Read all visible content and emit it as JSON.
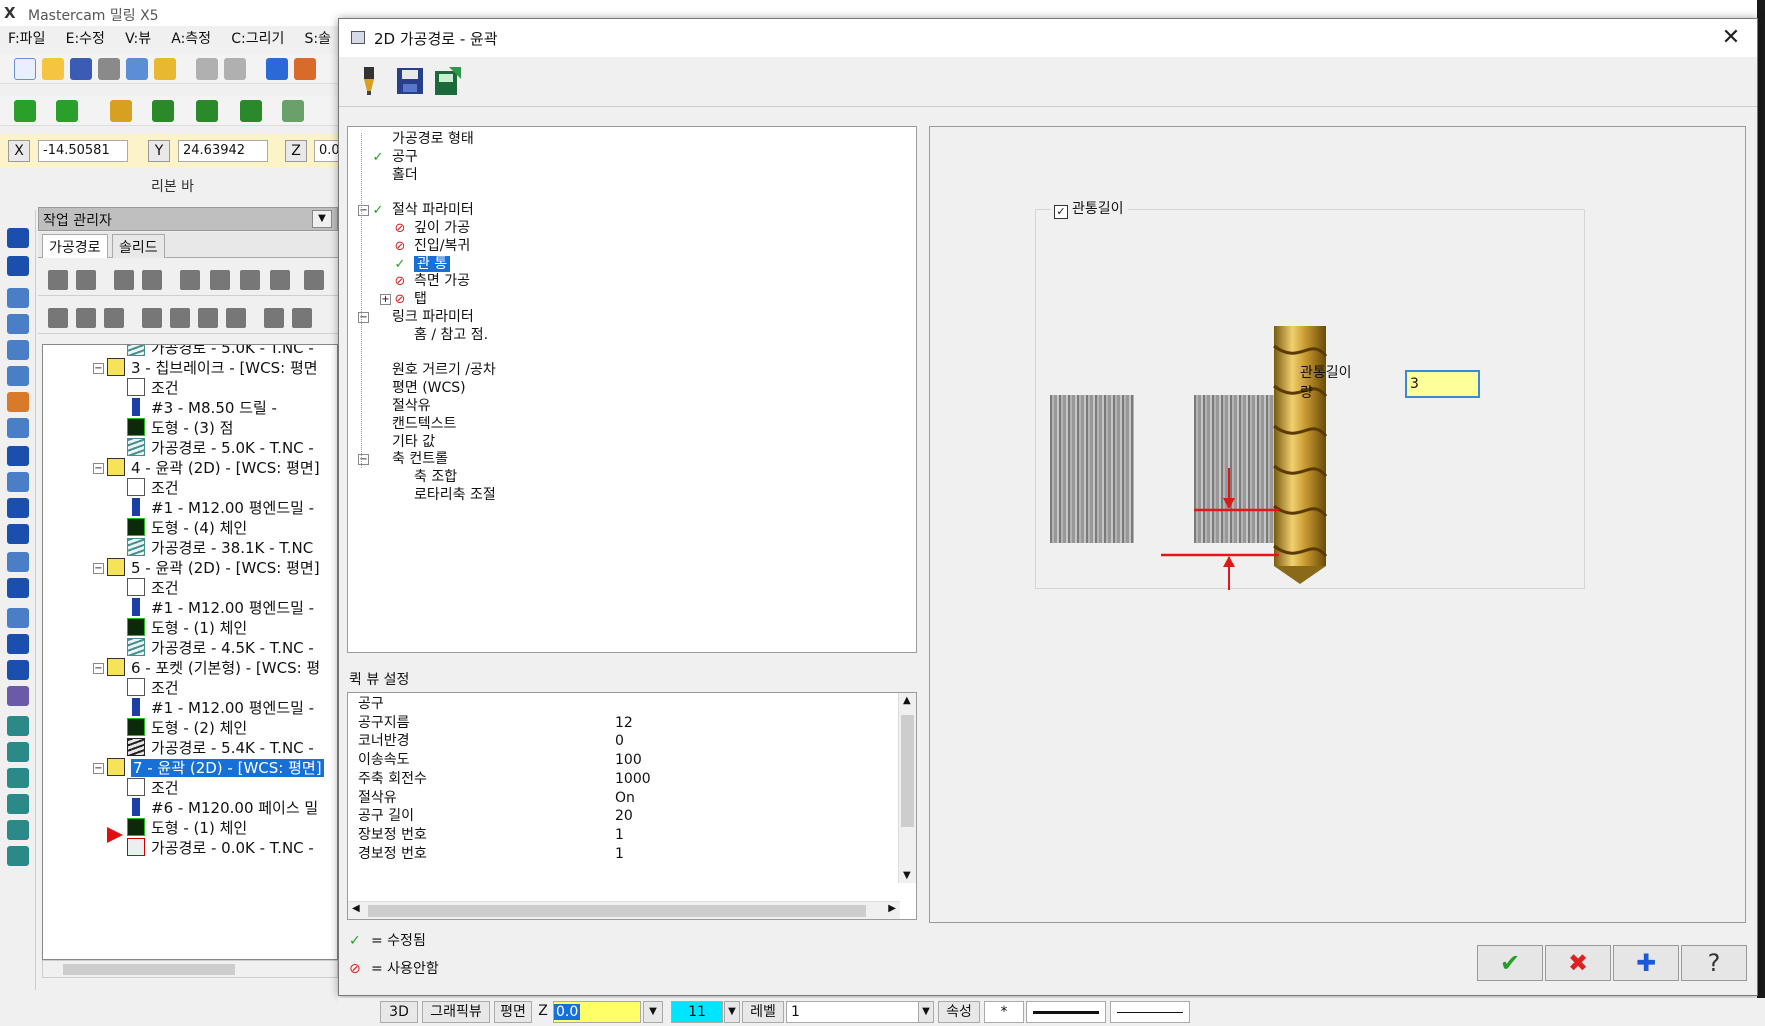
{
  "app": {
    "title": "Mastercam 밀링 X5",
    "menu": [
      "F:파일",
      "E:수정",
      "V:뷰",
      "A:측정",
      "C:그리기",
      "S:솔"
    ],
    "coords": {
      "x_label": "X",
      "x_value": "-14.50581",
      "y_label": "Y",
      "y_value": "24.63942",
      "z_label": "Z",
      "z_value": "0.0"
    },
    "ribbon_label": "리본 바"
  },
  "manager": {
    "title": "작업 관리자",
    "tabs": [
      "가공경로",
      "솔리드"
    ],
    "tree": [
      {
        "text": "가공경로 - 5.0K - T.NC -",
        "icon": "path",
        "level": 2
      },
      {
        "text": "3 - 칩브레이크 - [WCS: 평면",
        "icon": "folder",
        "level": 1
      },
      {
        "text": "조건",
        "icon": "cond",
        "level": 2
      },
      {
        "text": "#3 - M8.50 드릴 -",
        "icon": "tool",
        "level": 2
      },
      {
        "text": "도형 - (3) 점",
        "icon": "geo",
        "level": 2
      },
      {
        "text": "가공경로 - 5.0K - T.NC -",
        "icon": "path",
        "level": 2
      },
      {
        "text": "4 - 윤곽 (2D) - [WCS: 평면]",
        "icon": "folder",
        "level": 1
      },
      {
        "text": "조건",
        "icon": "cond",
        "level": 2
      },
      {
        "text": "#1 - M12.00 평엔드밀 -",
        "icon": "tool",
        "level": 2
      },
      {
        "text": "도형 - (4) 체인",
        "icon": "geo",
        "level": 2
      },
      {
        "text": "가공경로 - 38.1K - T.NC",
        "icon": "path",
        "level": 2
      },
      {
        "text": "5 - 윤곽 (2D) - [WCS: 평면]",
        "icon": "folder",
        "level": 1
      },
      {
        "text": "조건",
        "icon": "cond",
        "level": 2
      },
      {
        "text": "#1 - M12.00 평엔드밀 -",
        "icon": "tool",
        "level": 2
      },
      {
        "text": "도형 - (1) 체인",
        "icon": "geo",
        "level": 2
      },
      {
        "text": "가공경로 - 4.5K - T.NC -",
        "icon": "path",
        "level": 2
      },
      {
        "text": "6 - 포켓 (기본형) - [WCS: 평",
        "icon": "folder",
        "level": 1
      },
      {
        "text": "조건",
        "icon": "cond",
        "level": 2
      },
      {
        "text": "#1 - M12.00 평엔드밀 -",
        "icon": "tool",
        "level": 2
      },
      {
        "text": "도형 - (2) 체인",
        "icon": "geo",
        "level": 2
      },
      {
        "text": "가공경로 - 5.4K - T.NC -",
        "icon": "pathdark",
        "level": 2
      },
      {
        "text": "7 - 윤곽 (2D) - [WCS: 평면]",
        "icon": "folder",
        "level": 1,
        "selected": true
      },
      {
        "text": "조건",
        "icon": "cond",
        "level": 2
      },
      {
        "text": "#6 - M120.00 페이스 밀",
        "icon": "tool",
        "level": 2
      },
      {
        "text": "도형 - (1) 체인",
        "icon": "geo",
        "level": 2
      },
      {
        "text": "가공경로 - 0.0K - T.NC -",
        "icon": "pathx",
        "level": 2
      }
    ]
  },
  "dialog": {
    "title": "2D 가공경로 - 윤곽",
    "close": "✕",
    "param_tree": [
      {
        "label": "가공경로 형태",
        "mark": "",
        "level": 1
      },
      {
        "label": "공구",
        "mark": "ok",
        "level": 1
      },
      {
        "label": "홀더",
        "mark": "",
        "level": 1
      },
      {
        "label": "",
        "mark": "",
        "level": 1
      },
      {
        "label": "절삭 파라미터",
        "mark": "ok",
        "level": 1,
        "expander": "−"
      },
      {
        "label": "깊이 가공",
        "mark": "no",
        "level": 2
      },
      {
        "label": "진입/복귀",
        "mark": "no",
        "level": 2
      },
      {
        "label": "관 통",
        "mark": "ok",
        "level": 2,
        "selected": true
      },
      {
        "label": "측면 가공",
        "mark": "no",
        "level": 2
      },
      {
        "label": "탭",
        "mark": "no",
        "level": 2,
        "expander": "+"
      },
      {
        "label": "링크 파라미터",
        "mark": "",
        "level": 1,
        "expander": "−"
      },
      {
        "label": "홈 / 참고 점.",
        "mark": "",
        "level": 2
      },
      {
        "label": "",
        "mark": "",
        "level": 1
      },
      {
        "label": "원호 거르기 /공차",
        "mark": "",
        "level": 1
      },
      {
        "label": "평면 (WCS)",
        "mark": "",
        "level": 1
      },
      {
        "label": "절삭유",
        "mark": "",
        "level": 1
      },
      {
        "label": "캔드텍스트",
        "mark": "",
        "level": 1
      },
      {
        "label": "기타 값",
        "mark": "",
        "level": 1
      },
      {
        "label": "축 컨트롤",
        "mark": "",
        "level": 1,
        "expander": "−"
      },
      {
        "label": "축 조합",
        "mark": "",
        "level": 2
      },
      {
        "label": "로타리축 조절",
        "mark": "",
        "level": 2
      }
    ],
    "quickview_label": "퀵 뷰 설정",
    "quickview": [
      {
        "k": "공구",
        "v": ""
      },
      {
        "k": "공구지름",
        "v": "12"
      },
      {
        "k": "코너반경",
        "v": "0"
      },
      {
        "k": "이송속도",
        "v": "100"
      },
      {
        "k": "주축 회전수",
        "v": "1000"
      },
      {
        "k": "절삭유",
        "v": "On"
      },
      {
        "k": "공구 길이",
        "v": "20"
      },
      {
        "k": "장보정 번호",
        "v": "1"
      },
      {
        "k": "경보정 번호",
        "v": "1"
      }
    ],
    "legend": {
      "modified": "= 수정됨",
      "disabled": "= 사용안함"
    },
    "breakthrough": {
      "checkbox_label": "관통길이",
      "checked": true,
      "amount_label": "관통길이 량",
      "amount_value": "3"
    },
    "buttons": {
      "ok": "✔",
      "cancel": "✖",
      "add": "✚",
      "help": "?"
    }
  },
  "statusbar": {
    "view3d": "3D",
    "gview": "그래픽뷰",
    "plane": "평면",
    "z_label": "Z",
    "z_value": "0.0",
    "color_value": "11",
    "level_label": "레벨",
    "level_value": "1",
    "attr_label": "속성",
    "style_value": "*"
  },
  "colors": {
    "accent": "#1670d8",
    "ok_green": "#22a022",
    "no_red": "#e02020",
    "input_yellow": "#ffff99",
    "status_cyan": "#00e5ff"
  }
}
